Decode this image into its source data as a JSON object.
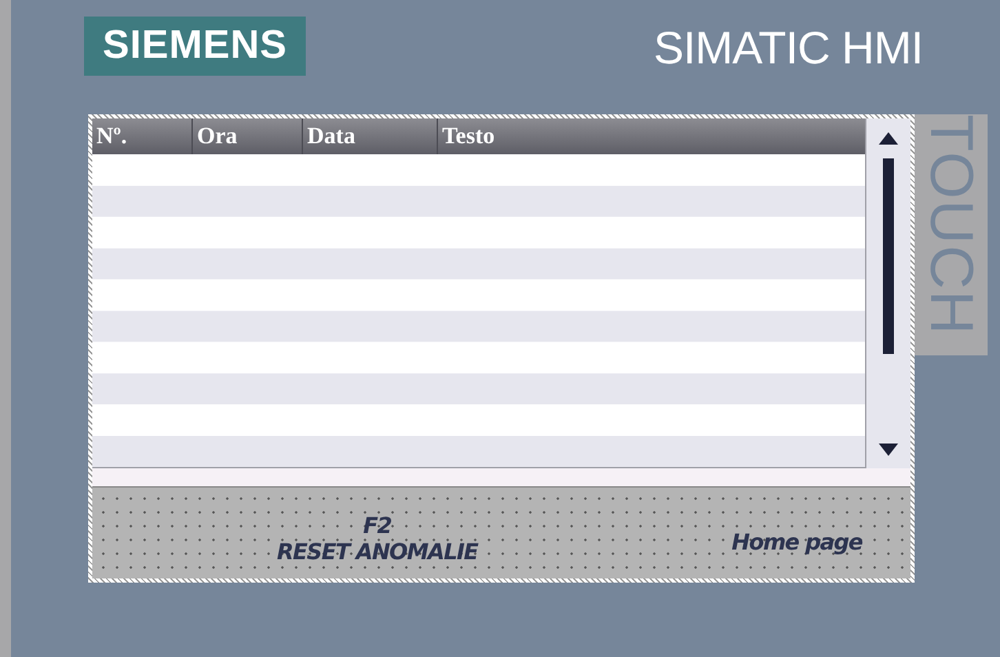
{
  "header": {
    "logo": "SIEMENS",
    "product": "SIMATIC HMI"
  },
  "side_label": "TOUCH",
  "alarm_view": {
    "columns": [
      "Nº.",
      "Ora",
      "Data",
      "Testo"
    ]
  },
  "function_keys": [
    {
      "key": "F2",
      "label": "RESET ANOMALIE"
    }
  ],
  "screen_link": "Home page"
}
